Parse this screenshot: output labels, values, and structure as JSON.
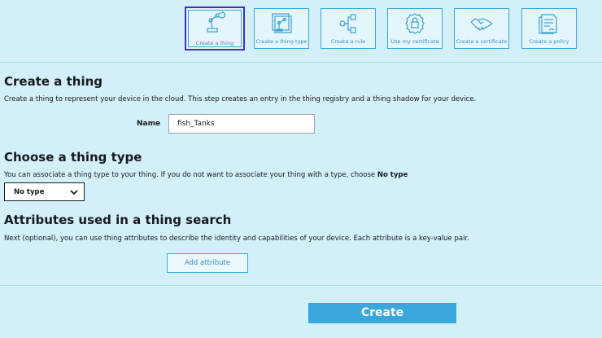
{
  "steps": [
    {
      "label": "Create a thing",
      "icon": "robot-arm-icon",
      "selected": true
    },
    {
      "label": "Create a thing type",
      "icon": "robot-arm-stack-icon",
      "selected": false
    },
    {
      "label": "Create a rule",
      "icon": "flow-nodes-icon",
      "selected": false
    },
    {
      "label": "Use my certificate",
      "icon": "certificate-badge-icon",
      "selected": false
    },
    {
      "label": "Create a certificate",
      "icon": "handshake-icon",
      "selected": false
    },
    {
      "label": "Create a policy",
      "icon": "policy-document-icon",
      "selected": false
    }
  ],
  "create_thing": {
    "heading": "Create a thing",
    "description": "Create a thing to represent your device in the cloud. This step creates an entry in the thing registry and a thing shadow for your device.",
    "name_label": "Name",
    "name_value": "fish_Tanks"
  },
  "thing_type": {
    "heading": "Choose a thing type",
    "description_prefix": "You can associate a thing type to your thing. If you do not want to associate your thing with a type, choose ",
    "description_bold": "No type",
    "select_value": "No type"
  },
  "attributes": {
    "heading": "Attributes used in a thing search",
    "description": "Next (optional), you can use thing attributes to describe the identity and capabilities of your device. Each attribute is a key-value pair.",
    "add_button": "Add attribute"
  },
  "create_button": "Create",
  "colors": {
    "background": "#d3f0f8",
    "accent": "#3aa6db",
    "selected_border": "#3d30c8"
  }
}
